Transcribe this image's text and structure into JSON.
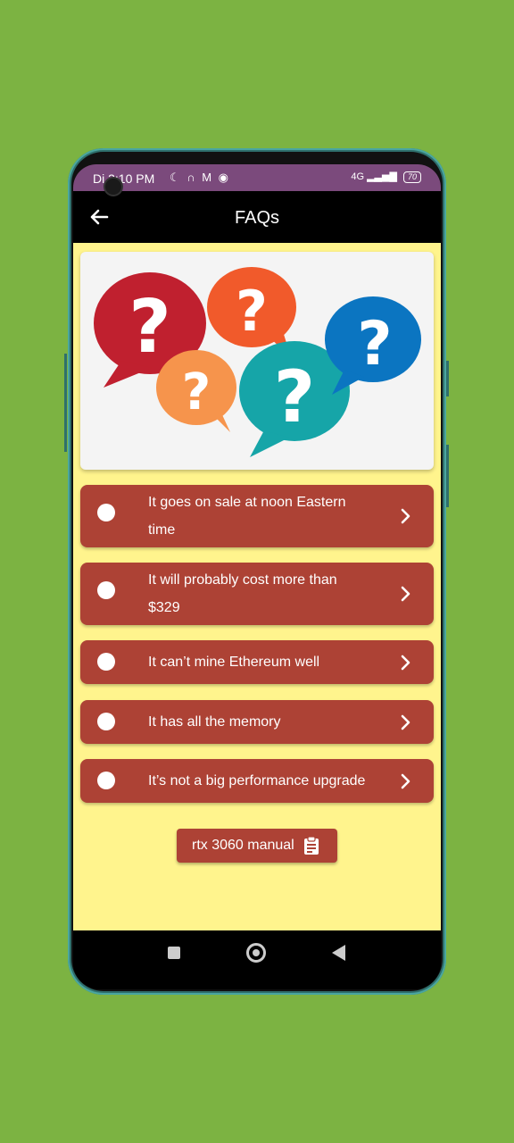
{
  "status_bar": {
    "time": "Di 3:10 PM",
    "icons": "☾ ∩ M ◉",
    "network": "4G",
    "battery": "70"
  },
  "toolbar": {
    "title": "FAQs"
  },
  "hero": {
    "image": "question-bubbles-illustration"
  },
  "faq_items": [
    {
      "text": "It goes on sale at noon Eastern time"
    },
    {
      "text": "It will probably cost more than $329"
    },
    {
      "text": "It can’t mine Ethereum well"
    },
    {
      "text": "It has all the memory"
    },
    {
      "text": "It’s not a big performance upgrade"
    }
  ],
  "manual_button": {
    "label": "rtx 3060 manual",
    "icon": "clipboard-icon"
  },
  "colors": {
    "background": "#7cb342",
    "status_bar": "#7b4a7c",
    "content_bg": "#fff48d",
    "accent": "#ad4235",
    "bubble_red": "#c0202f",
    "bubble_orange": "#f15a2b",
    "bubble_light_orange": "#f6944c",
    "bubble_teal": "#16a5a8",
    "bubble_blue": "#0b75c1"
  }
}
